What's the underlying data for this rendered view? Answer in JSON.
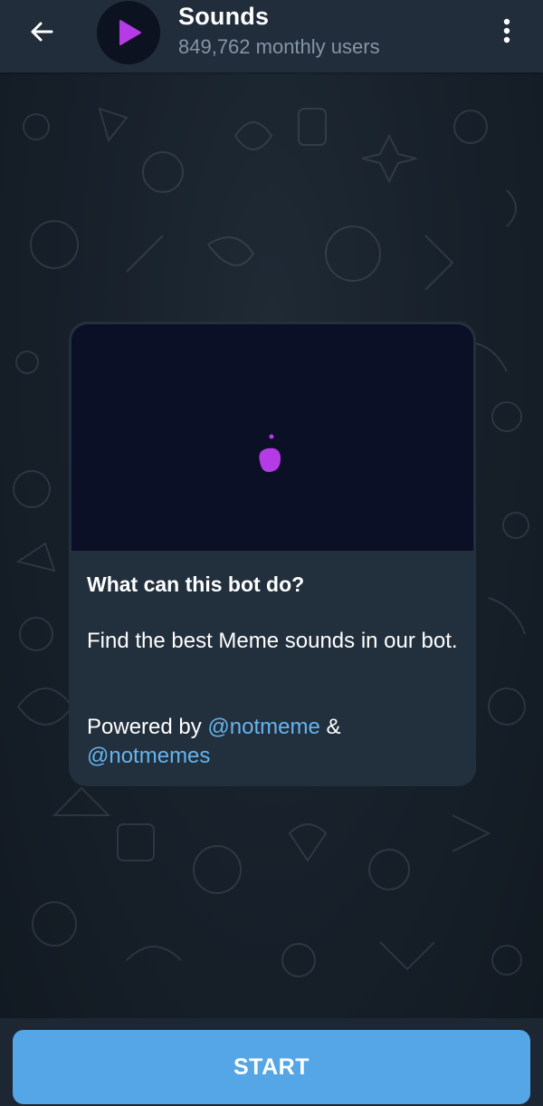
{
  "header": {
    "back_icon": "arrow-left-icon",
    "avatar_icon": "play-triangle-icon",
    "title": "Sounds",
    "subtitle": "849,762 monthly users",
    "menu_icon": "vertical-dots-icon"
  },
  "card": {
    "preview_icon": "purple-blob-icon",
    "heading": "What can this bot do?",
    "description": "Find the best Meme sounds in our bot.",
    "powered_prefix": "Powered by ",
    "link1": "@notmeme",
    "joiner": " & ",
    "link2": "@notmemes"
  },
  "footer": {
    "start_label": "START"
  },
  "colors": {
    "header_bg": "#212d3b",
    "card_bg": "#222f3c",
    "accent": "#54a6e6",
    "link": "#66b4ee",
    "avatar_icon": "#b53be6"
  }
}
